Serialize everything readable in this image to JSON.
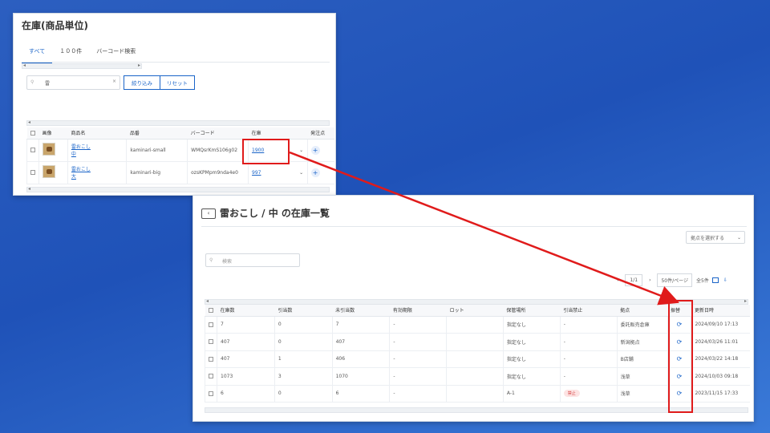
{
  "panel1": {
    "title": "在庫(商品単位)",
    "tabs": [
      {
        "label": "すべて",
        "active": true
      },
      {
        "label": "１００件",
        "active": false
      },
      {
        "label": "バーコード検索",
        "active": false
      }
    ],
    "search_value": "雷",
    "search_clear": "×",
    "filter_button": "絞り込み",
    "reset_button": "リセット",
    "columns": [
      "画像",
      "商品名",
      "品番",
      "バーコード",
      "在庫",
      "",
      "発注点"
    ],
    "rows": [
      {
        "name_line1": "雷おこし",
        "name_line2": "中",
        "sku": "kaminari-small",
        "barcode": "WMQsrKmS106g02",
        "stock": "1900",
        "chevron": "⌄",
        "order_point": "+"
      },
      {
        "name_line1": "雷おこし",
        "name_line2": "大",
        "sku": "kaminari-big",
        "barcode": "ozsKPMpm9nda4e0",
        "stock": "997",
        "chevron": "⌄",
        "order_point": "+"
      }
    ]
  },
  "panel2": {
    "back_icon": "‹",
    "title": "雷おこし / 中 の在庫一覧",
    "location_select": "拠点を選択する",
    "search_placeholder": "検索",
    "pager": {
      "prev": "‹",
      "page": "1/1",
      "next": "›",
      "per_page": "50件/ページ",
      "total": "全5件"
    },
    "columns": [
      "在庫数",
      "引当数",
      "未引当数",
      "有効期限",
      "ロット",
      "保管場所",
      "引当禁止",
      "拠点",
      "振替",
      "更新日時"
    ],
    "rows": [
      {
        "stock": "7",
        "allocated": "0",
        "unallocated": "7",
        "expiry": "-",
        "lot": "",
        "place": "指定なし",
        "ban": "-",
        "base": "委託販売倉庫",
        "updated": "2024/09/10 17:13"
      },
      {
        "stock": "407",
        "allocated": "0",
        "unallocated": "407",
        "expiry": "-",
        "lot": "",
        "place": "指定なし",
        "ban": "-",
        "base": "新潟拠点",
        "updated": "2024/03/26 11:01"
      },
      {
        "stock": "407",
        "allocated": "1",
        "unallocated": "406",
        "expiry": "-",
        "lot": "",
        "place": "指定なし",
        "ban": "-",
        "base": "B店舗",
        "updated": "2024/03/22 14:18"
      },
      {
        "stock": "1073",
        "allocated": "3",
        "unallocated": "1070",
        "expiry": "-",
        "lot": "",
        "place": "指定なし",
        "ban": "-",
        "base": "浅草",
        "updated": "2024/10/03 09:18"
      },
      {
        "stock": "6",
        "allocated": "0",
        "unallocated": "6",
        "expiry": "-",
        "lot": "",
        "place": "A-1",
        "ban": "禁止",
        "base": "浅草",
        "updated": "2023/11/15 17:33"
      }
    ],
    "refresh_icon": "⟳"
  },
  "colors": {
    "accent": "#1a64c8",
    "annotation": "#e01b1b",
    "background_top": "#2c5fc0",
    "background_bottom": "#3a7ad8"
  }
}
